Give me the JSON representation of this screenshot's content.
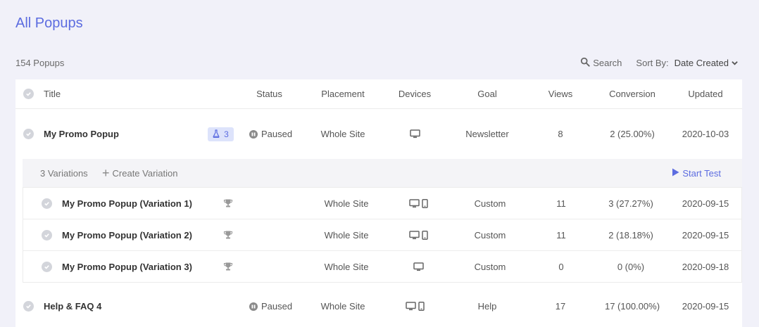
{
  "page": {
    "title": "All Popups",
    "count": "154 Popups"
  },
  "toolbar": {
    "search_label": "Search",
    "sort_label": "Sort By:",
    "sort_value": "Date Created"
  },
  "columns": {
    "title": "Title",
    "status": "Status",
    "placement": "Placement",
    "devices": "Devices",
    "goal": "Goal",
    "views": "Views",
    "conversion": "Conversion",
    "updated": "Updated"
  },
  "rows": [
    {
      "title": "My Promo Popup",
      "variations_badge": "3",
      "status": "Paused",
      "placement": "Whole Site",
      "devices": [
        "desktop"
      ],
      "goal": "Newsletter",
      "views": "8",
      "conversion": "2 (25.00%)",
      "updated": "2020-10-03"
    },
    {
      "title": "Help & FAQ 4",
      "status": "Paused",
      "placement": "Whole Site",
      "devices": [
        "desktop",
        "mobile"
      ],
      "goal": "Help",
      "views": "17",
      "conversion": "17 (100.00%)",
      "updated": "2020-09-15"
    }
  ],
  "variations": {
    "count_label": "3 Variations",
    "create_label": "Create Variation",
    "start_test_label": "Start Test",
    "items": [
      {
        "title": "My Promo Popup (Variation 1)",
        "placement": "Whole Site",
        "devices": [
          "desktop",
          "mobile"
        ],
        "goal": "Custom",
        "views": "11",
        "conversion": "3 (27.27%)",
        "updated": "2020-09-15"
      },
      {
        "title": "My Promo Popup (Variation 2)",
        "placement": "Whole Site",
        "devices": [
          "desktop",
          "mobile"
        ],
        "goal": "Custom",
        "views": "11",
        "conversion": "2 (18.18%)",
        "updated": "2020-09-15"
      },
      {
        "title": "My Promo Popup (Variation 3)",
        "placement": "Whole Site",
        "devices": [
          "desktop"
        ],
        "goal": "Custom",
        "views": "0",
        "conversion": "0 (0%)",
        "updated": "2020-09-18"
      }
    ]
  },
  "colors": {
    "accent": "#5c6ce0",
    "background": "#f1f1f9",
    "badge_bg": "#dde3fb"
  }
}
